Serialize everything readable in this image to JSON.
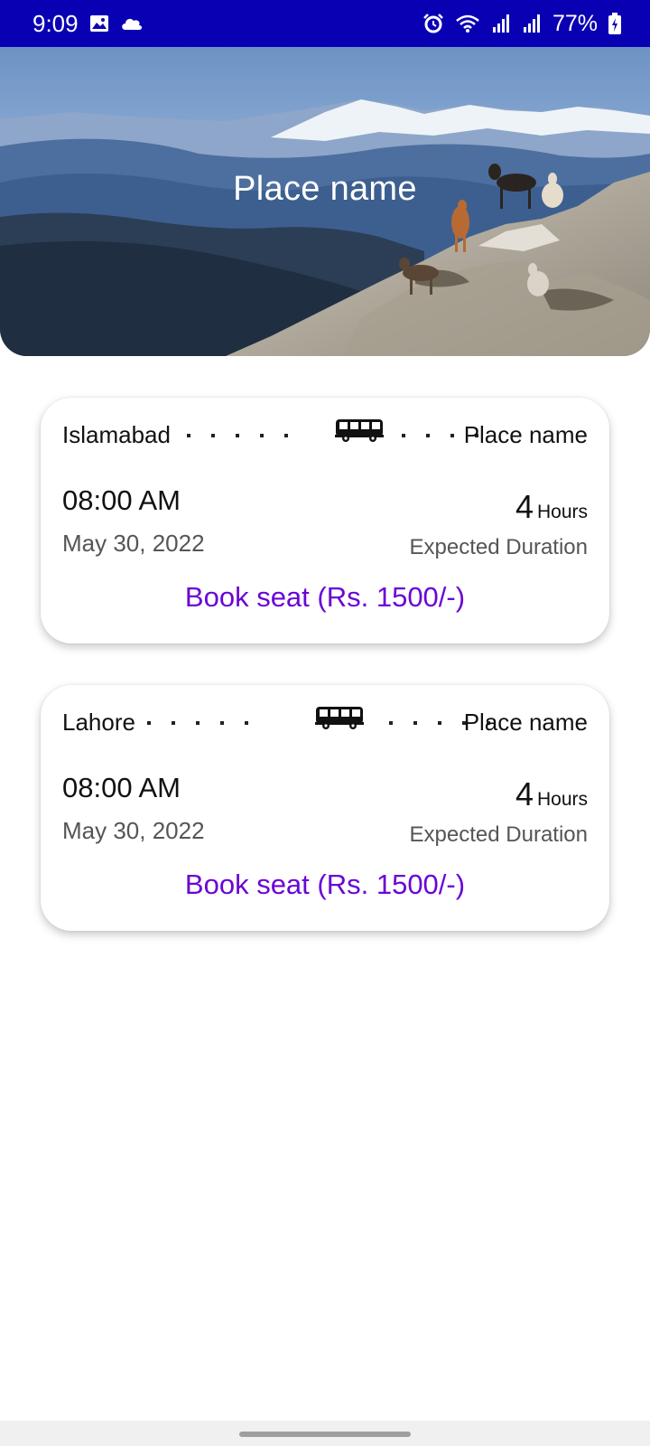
{
  "status_bar": {
    "time": "9:09",
    "battery": "77%",
    "icons": [
      "image-icon",
      "cloud-icon",
      "alarm-icon",
      "wifi-icon",
      "signal-icon",
      "signal-icon-2",
      "battery-icon"
    ]
  },
  "hero": {
    "title": "Place name",
    "image": "mountain-landscape-with-goats"
  },
  "trips": [
    {
      "from": "Islamabad",
      "to": "Place name",
      "time": "08:00 AM",
      "date": "May 30, 2022",
      "duration_value": "4",
      "duration_unit": "Hours",
      "duration_label": "Expected Duration",
      "book_label": "Book seat (Rs. 1500/-)"
    },
    {
      "from": "Lahore",
      "to": "Place name",
      "time": "08:00 AM",
      "date": "May 30, 2022",
      "duration_value": "4",
      "duration_unit": "Hours",
      "duration_label": "Expected Duration",
      "book_label": "Book seat (Rs. 1500/-)"
    }
  ],
  "colors": {
    "status_bar": "#0a00b3",
    "accent": "#6a05d6"
  }
}
